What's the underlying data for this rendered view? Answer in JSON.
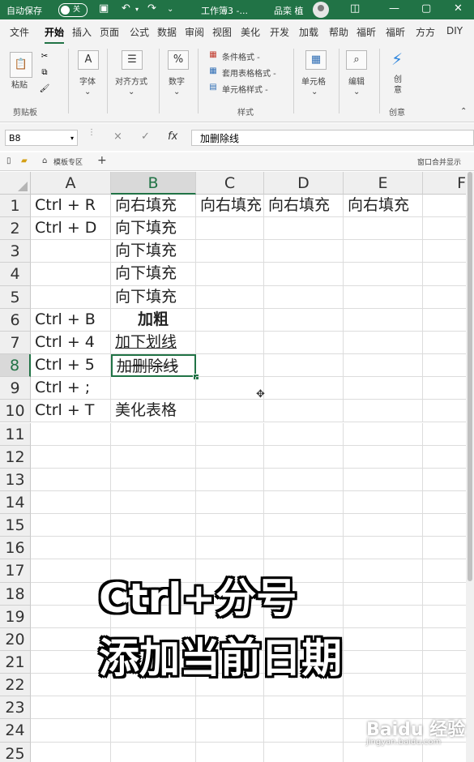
{
  "titlebar": {
    "autosave_label": "自动保存",
    "autosave_state": "关",
    "doc_title": "工作簿3 -...",
    "user_name": "品栾 植"
  },
  "ribbon_tabs": [
    "文件",
    "开始",
    "插入",
    "页面",
    "公式",
    "数据",
    "审阅",
    "视图",
    "美化",
    "开发",
    "加载",
    "帮助",
    "福昕",
    "福昕",
    "方方",
    "DIY"
  ],
  "active_tab": "开始",
  "ribbon": {
    "paste_label": "粘贴",
    "clipboard_group": "剪贴板",
    "font_label": "字体",
    "align_label": "对齐方式",
    "number_label": "数字",
    "cond_format_label": "条件格式 -",
    "table_format_label": "套用表格格式 -",
    "cell_style_label": "单元格样式 -",
    "styles_group": "样式",
    "cells_label": "单元格",
    "edit_label": "编辑",
    "create_label": "创意",
    "create_group": "创意"
  },
  "formula_bar": {
    "name_box": "B8",
    "cancel_icon": "×",
    "confirm_icon": "✓",
    "fx_label": "fx",
    "formula": "加删除线"
  },
  "workbook_strip": {
    "template_label": "模板专区",
    "add_label": "+",
    "right_label": "窗口合并显示"
  },
  "columns": [
    "A",
    "B",
    "C",
    "D",
    "E",
    "F"
  ],
  "selected_column": "B",
  "selected_row": 8,
  "rows": [
    "1",
    "2",
    "3",
    "4",
    "5",
    "6",
    "7",
    "8",
    "9",
    "10",
    "11",
    "12",
    "13",
    "14",
    "15",
    "16",
    "17",
    "18",
    "19",
    "20",
    "21",
    "22",
    "23",
    "24",
    "25"
  ],
  "cells": {
    "A1": "Ctrl + R",
    "A2": "Ctrl + D",
    "A6": "Ctrl + B",
    "A7": "Ctrl + 4",
    "A8": "Ctrl + 5",
    "A9": "Ctrl + ;",
    "A10": "Ctrl + T",
    "B1": "向右填充",
    "C1": "向右填充",
    "D1": "向右填充",
    "E1": "向右填充",
    "B2": "向下填充",
    "B3": "向下填充",
    "B4": "向下填充",
    "B5": "向下填充",
    "B6": "加粗",
    "B7": "加下划线",
    "B8": "加删除线",
    "B10": "美化表格"
  },
  "overlay": {
    "line1": "Ctrl+分号",
    "line2": "添加当前日期"
  },
  "watermark": {
    "logo": "Baidu 经验",
    "url": "jingyan.baidu.com"
  },
  "colors": {
    "excel_green": "#217346",
    "overlay_text": "#ffffff"
  }
}
